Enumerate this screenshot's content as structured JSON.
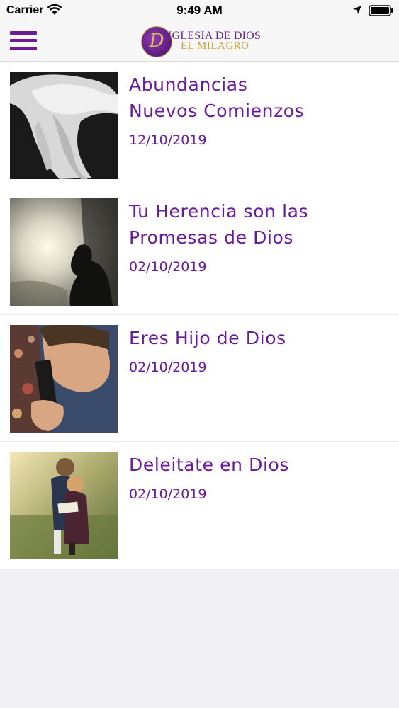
{
  "status_bar": {
    "carrier": "Carrier",
    "time": "9:49 AM"
  },
  "header": {
    "logo_line1": "IGLESIA DE DIOS",
    "logo_line2": "EL MILAGRO",
    "logo_mark": "D",
    "menu_icon": "hamburger-menu-icon",
    "accent_color": "#6a1b9a"
  },
  "posts": [
    {
      "title_line1": "Abundancias",
      "title_line2": "Nuevos Comienzos",
      "date": "12/10/2019",
      "image": "hands-photo"
    },
    {
      "title_line1": "Tu Herencia son las",
      "title_line2": "Promesas de Dios",
      "date": "02/10/2019",
      "image": "praying-silhouette-photo"
    },
    {
      "title_line1": "Eres Hijo de Dios",
      "title_line2": "",
      "date": "02/10/2019",
      "image": "child-with-bible-photo"
    },
    {
      "title_line1": "Deleitate en Dios",
      "title_line2": "",
      "date": "02/10/2019",
      "image": "children-reading-photo"
    }
  ]
}
